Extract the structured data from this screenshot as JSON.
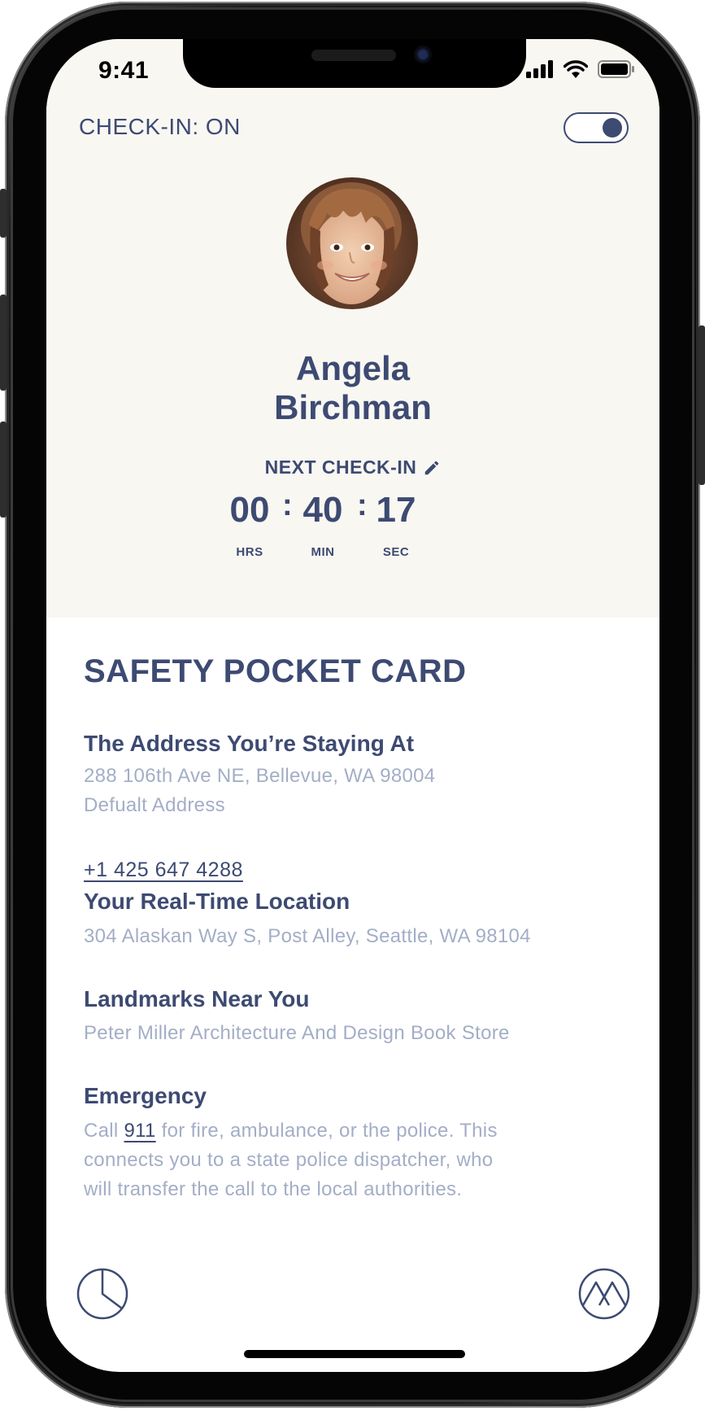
{
  "status_bar": {
    "time": "9:41"
  },
  "checkin": {
    "label": "CHECK-IN: ON",
    "toggle_on": true
  },
  "profile": {
    "first_name": "Angela",
    "last_name": "Birchman"
  },
  "next_checkin": {
    "label": "NEXT CHECK-IN",
    "hours": "00",
    "minutes": "40",
    "seconds": "17",
    "hours_unit": "HRS",
    "minutes_unit": "MIN",
    "seconds_unit": "SEC"
  },
  "card": {
    "title": "SAFETY POCKET CARD",
    "address": {
      "heading": "The Address You’re Staying At",
      "line1": "288 106th Ave NE, Bellevue, WA 98004",
      "line2": "Defualt Address",
      "phone": "+1 425 647 4288"
    },
    "location": {
      "heading": "Your Real-Time Location",
      "text": "304 Alaskan Way S, Post Alley, Seattle, WA 98104"
    },
    "landmarks": {
      "heading": "Landmarks Near You",
      "text": "Peter Miller Architecture And Design Book Store"
    },
    "emergency": {
      "heading": "Emergency",
      "prefix": "Call ",
      "number": "911",
      "suffix": " for fire, ambulance, or the police. This",
      "line2": "connects you to a state police dispatcher, who",
      "line3": "will transfer the call to the local authorities."
    }
  },
  "nav": {
    "left_icon": "pie-chart-icon",
    "right_icon": "mountain-logo-icon"
  },
  "colors": {
    "primary": "#3d4a72",
    "muted": "#a3aec6",
    "header_bg": "#f9f7f2"
  }
}
